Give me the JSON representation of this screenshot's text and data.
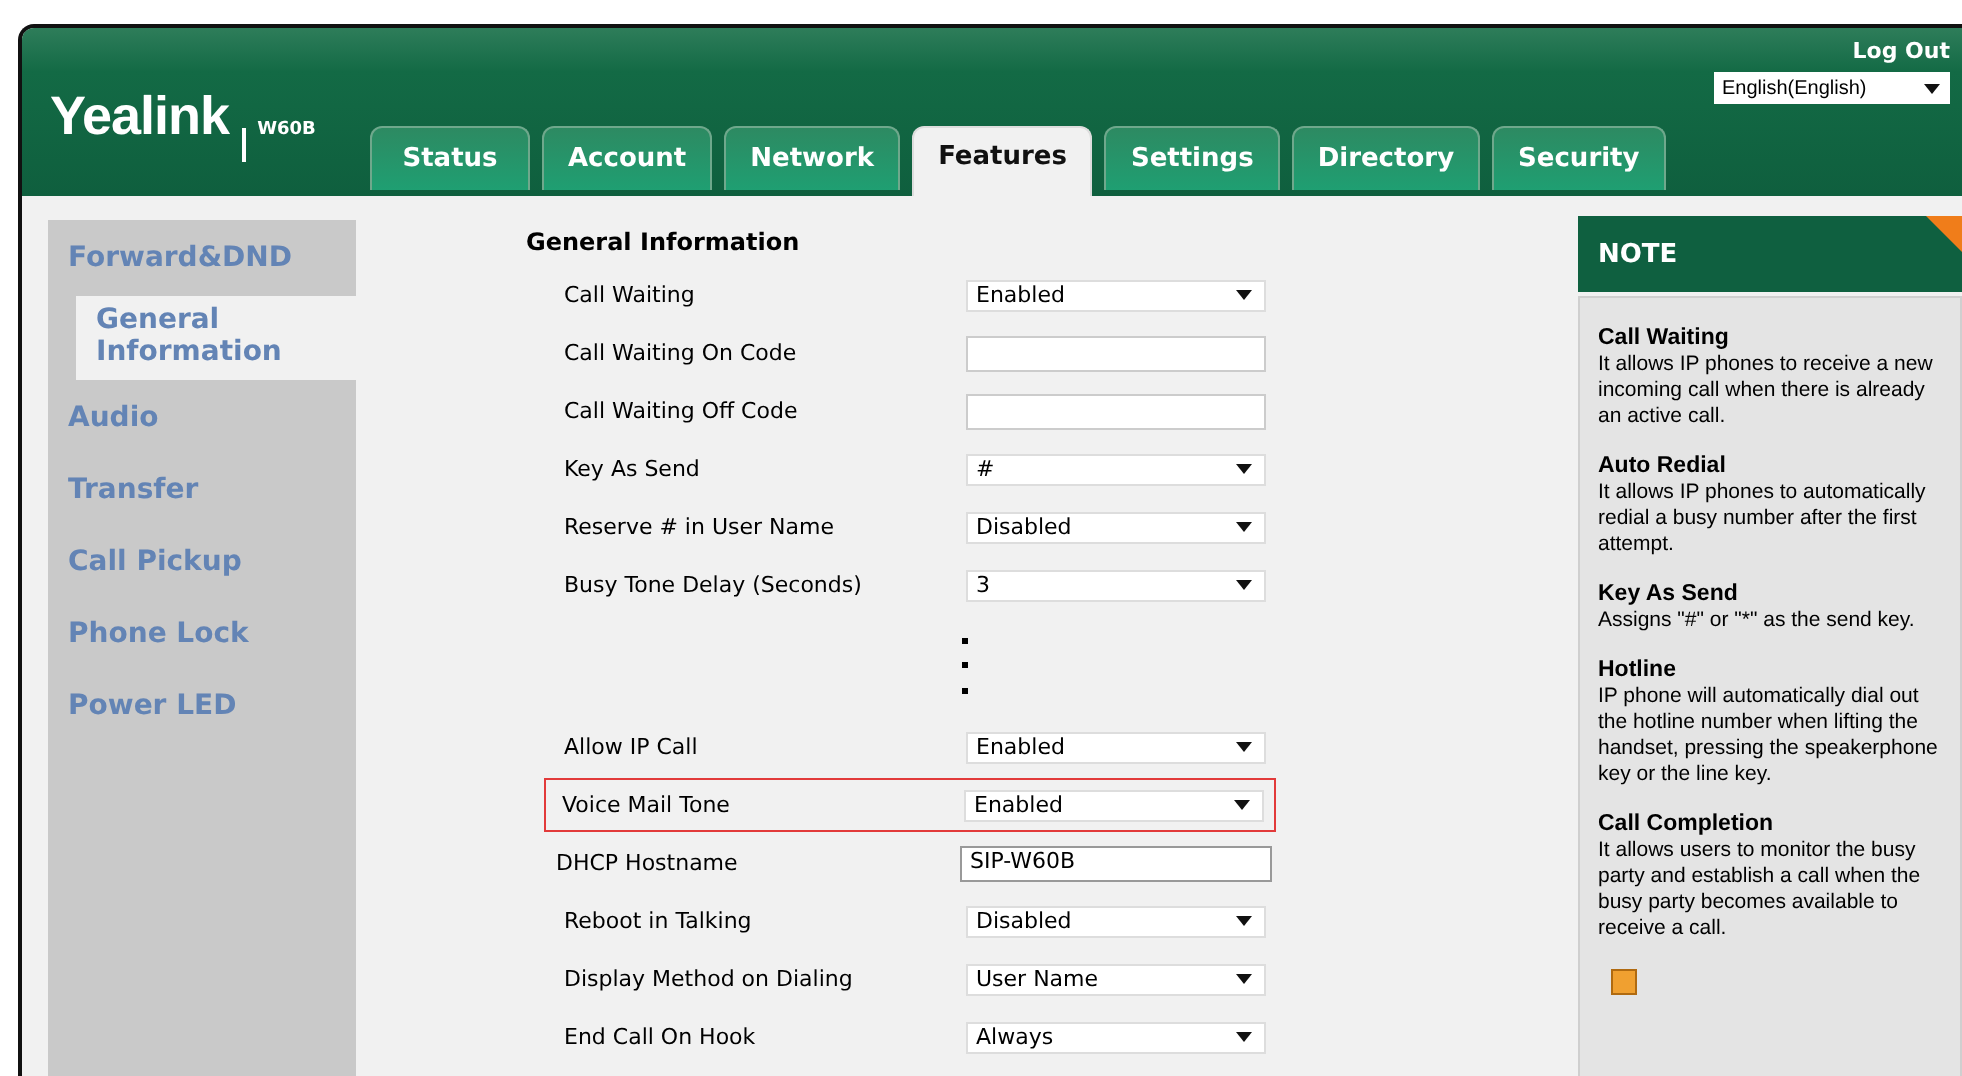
{
  "header": {
    "logo": "Yealink",
    "model": "W60B",
    "logout": "Log Out",
    "language": "English(English)"
  },
  "tabs": [
    {
      "label": "Status",
      "selected": false
    },
    {
      "label": "Account",
      "selected": false
    },
    {
      "label": "Network",
      "selected": false
    },
    {
      "label": "Features",
      "selected": true
    },
    {
      "label": "Settings",
      "selected": false
    },
    {
      "label": "Directory",
      "selected": false
    },
    {
      "label": "Security",
      "selected": false
    }
  ],
  "sidebar": {
    "items": [
      {
        "label": "Forward&DND",
        "selected": false
      },
      {
        "label": "General Information",
        "selected": true
      },
      {
        "label": "Audio",
        "selected": false
      },
      {
        "label": "Transfer",
        "selected": false
      },
      {
        "label": "Call Pickup",
        "selected": false
      },
      {
        "label": "Phone Lock",
        "selected": false
      },
      {
        "label": "Power LED",
        "selected": false
      }
    ]
  },
  "form": {
    "heading": "General Information",
    "rows": [
      {
        "kind": "select",
        "label": "Call Waiting",
        "value": "Enabled",
        "highlighted": false
      },
      {
        "kind": "input",
        "label": "Call Waiting On Code",
        "highlighted": false
      },
      {
        "kind": "input",
        "label": "Call Waiting Off Code",
        "highlighted": false
      },
      {
        "kind": "select",
        "label": "Key As Send",
        "value": "#",
        "highlighted": false
      },
      {
        "kind": "select",
        "label": "Reserve # in User Name",
        "value": "Disabled",
        "highlighted": false
      },
      {
        "kind": "select",
        "label": "Busy Tone Delay (Seconds)",
        "value": "3",
        "highlighted": false
      },
      {
        "kind": "gap"
      },
      {
        "kind": "select",
        "label": "Allow IP Call",
        "value": "Enabled",
        "highlighted": false
      },
      {
        "kind": "select",
        "label": "Voice Mail Tone",
        "value": "Enabled",
        "highlighted": true
      },
      {
        "kind": "input",
        "label": "DHCP Hostname",
        "value": "SIP-W60B",
        "highlighted": false
      },
      {
        "kind": "select",
        "label": "Reboot in Talking",
        "value": "Disabled",
        "highlighted": false
      },
      {
        "kind": "select",
        "label": "Display Method on Dialing",
        "value": "User Name",
        "highlighted": false
      },
      {
        "kind": "select",
        "label": "End Call On Hook",
        "value": "Always",
        "highlighted": false
      }
    ]
  },
  "note": {
    "title": "NOTE",
    "entries": [
      {
        "title": "Call Waiting",
        "text": "It allows IP phones to receive a new incoming call when there is already an active call."
      },
      {
        "title": "Auto Redial",
        "text": "It allows IP phones to automatically redial a busy number after the first attempt."
      },
      {
        "title": "Key As Send",
        "text": "Assigns \"#\" or \"*\" as the send key."
      },
      {
        "title": "Hotline",
        "text": "IP phone will automatically dial out the hotline number when lifting the handset, pressing the speakerphone key or the line key."
      },
      {
        "title": "Call Completion",
        "text": "It allows users to monitor the busy party and establish a call when the busy party becomes available to receive a call."
      }
    ]
  }
}
